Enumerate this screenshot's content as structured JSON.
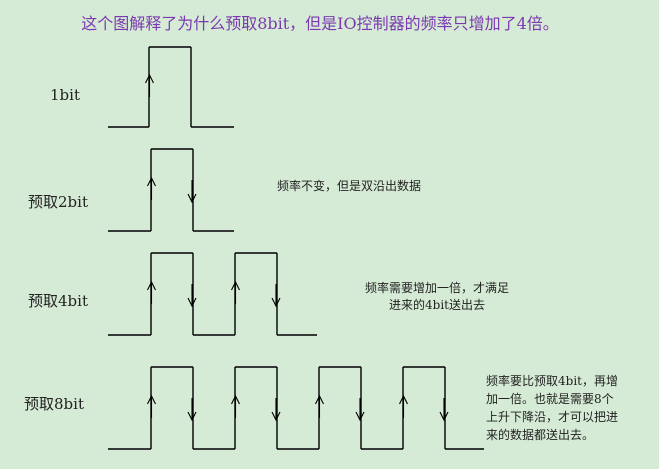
{
  "title": "这个图解释了为什么预取8bit，但是IO控制器的频率只增加了4倍。",
  "rows": [
    {
      "label": "1bit",
      "pulses": 1
    },
    {
      "label": "预取2bit",
      "pulses": 1,
      "note_lines": [
        "频率不变，但是双沿出数据"
      ]
    },
    {
      "label": "预取4bit",
      "pulses": 2,
      "note_lines": [
        "频率需要增加一倍，才满足",
        "进来的4bit送出去"
      ]
    },
    {
      "label": "预取8bit",
      "pulses": 4,
      "note_lines": [
        "频率要比预取4bit，再增",
        "加一倍。也就是需要8个",
        "上升下降沿，才可以把进",
        "来的数据都送出去。"
      ]
    }
  ],
  "colors": {
    "background": "#d6ebd6",
    "title": "#7b38b0",
    "waveform": "#000000",
    "text": "#222222"
  }
}
